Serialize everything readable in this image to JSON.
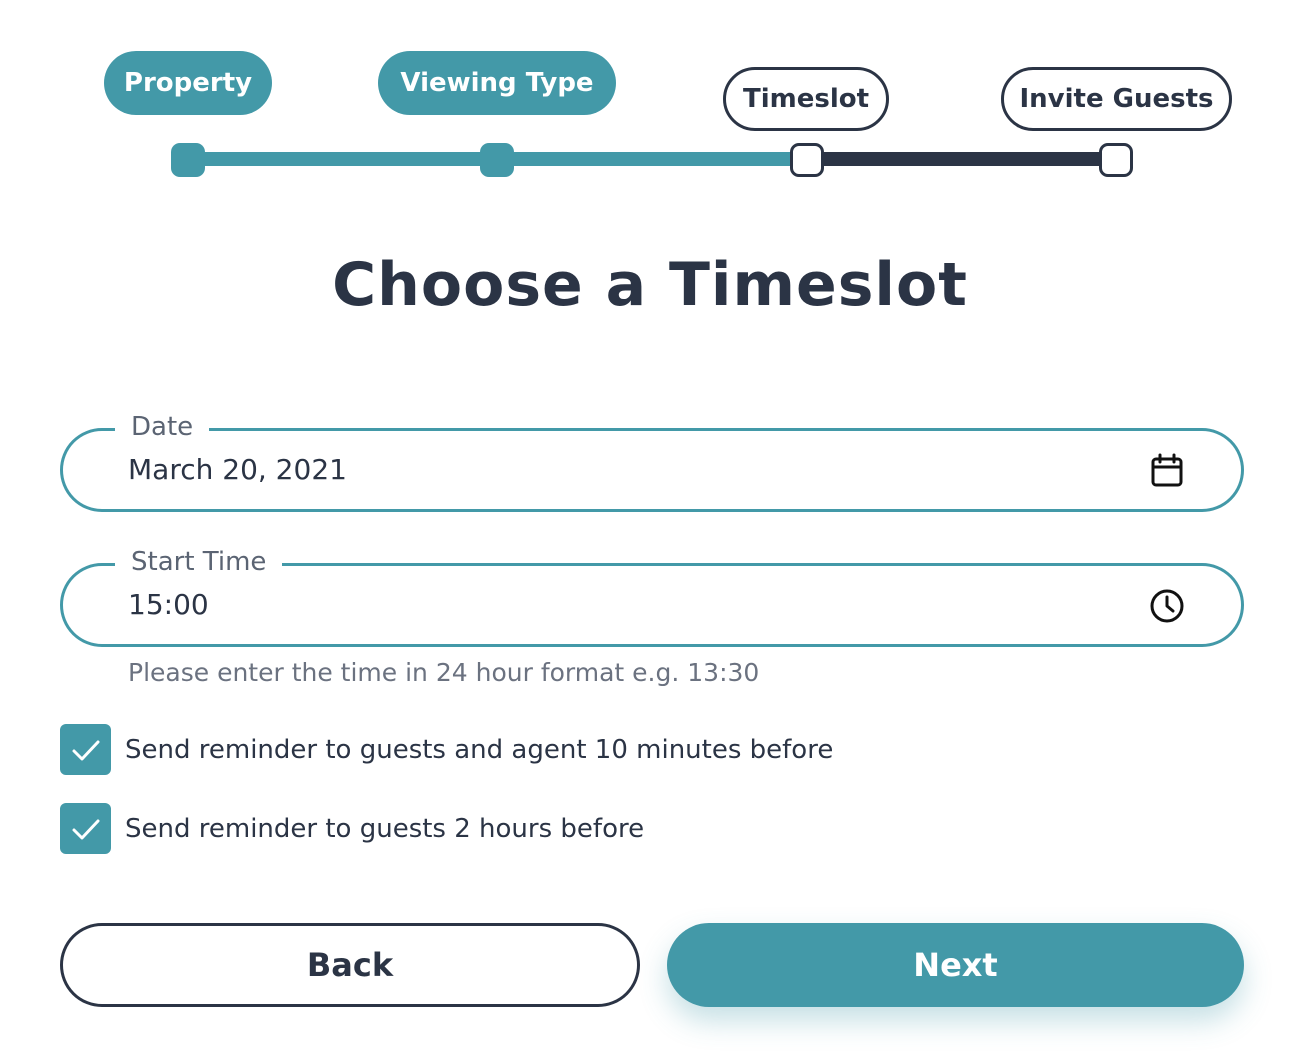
{
  "stepper": {
    "steps": [
      {
        "label": "Property",
        "state": "complete"
      },
      {
        "label": "Viewing Type",
        "state": "complete"
      },
      {
        "label": "Timeslot",
        "state": "current"
      },
      {
        "label": "Invite Guests",
        "state": "upcoming"
      }
    ]
  },
  "page": {
    "title": "Choose a Timeslot"
  },
  "form": {
    "date": {
      "label": "Date",
      "value": "March 20, 2021",
      "icon": "calendar-icon"
    },
    "start_time": {
      "label": "Start Time",
      "value": "15:00",
      "icon": "clock-icon",
      "hint": "Please enter the time in 24 hour format e.g. 13:30"
    },
    "reminders": [
      {
        "label": "Send reminder to guests and agent 10 minutes before",
        "checked": true
      },
      {
        "label": "Send reminder to guests 2 hours before",
        "checked": true
      }
    ]
  },
  "actions": {
    "back_label": "Back",
    "next_label": "Next"
  },
  "colors": {
    "accent": "#4399a8",
    "dark": "#2b3445",
    "muted": "#6b7280",
    "background": "#ffffff"
  }
}
